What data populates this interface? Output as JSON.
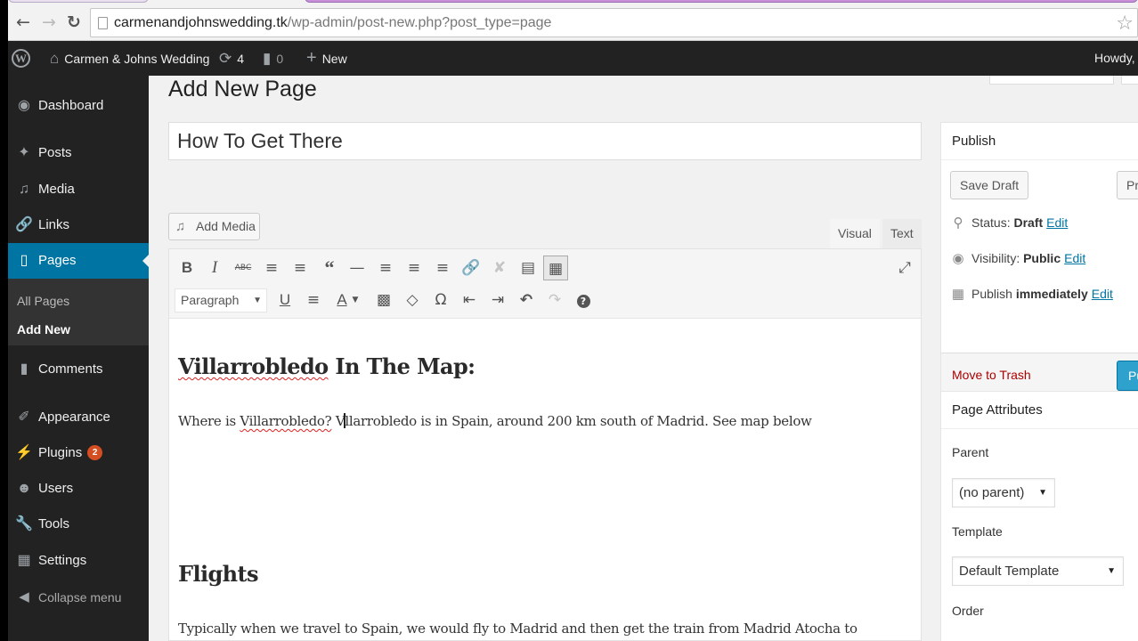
{
  "browser": {
    "url_domain": "carmenandjohnswedding.tk",
    "url_path": "/wp-admin/post-new.php?post_type=page",
    "back_icon": "back-arrow-icon",
    "forward_icon": "forward-arrow-icon",
    "reload_icon": "reload-icon",
    "bookmark_icon": "star-icon"
  },
  "adminbar": {
    "site_name": "Carmen & Johns Wedding",
    "updates_count": "4",
    "comments_count": "0",
    "new_label": "New",
    "howdy": "Howdy,"
  },
  "sidebar": {
    "items": [
      {
        "label": "Dashboard",
        "icon": "dashboard-icon"
      },
      {
        "label": "Posts",
        "icon": "pin-icon"
      },
      {
        "label": "Media",
        "icon": "media-icon"
      },
      {
        "label": "Links",
        "icon": "link-icon"
      },
      {
        "label": "Pages",
        "icon": "pages-icon",
        "current": true
      },
      {
        "label": "Comments",
        "icon": "comment-icon"
      },
      {
        "label": "Appearance",
        "icon": "brush-icon"
      },
      {
        "label": "Plugins",
        "icon": "plug-icon",
        "badge": "2"
      },
      {
        "label": "Users",
        "icon": "user-icon"
      },
      {
        "label": "Tools",
        "icon": "wrench-icon"
      },
      {
        "label": "Settings",
        "icon": "settings-icon"
      }
    ],
    "submenu": [
      {
        "label": "All Pages"
      },
      {
        "label": "Add New",
        "active": true
      }
    ],
    "collapse_label": "Collapse menu"
  },
  "main": {
    "page_title": "Add New Page",
    "post_title_value": "How To Get There",
    "add_media_label": "Add Media",
    "tabs": {
      "visual": "Visual",
      "text": "Text"
    },
    "format_select_value": "Paragraph",
    "content": {
      "heading1": "Villarrobledo In The Map:",
      "para1_a": "Where is ",
      "para1_spell": "Villarrobledo?",
      "para1_b": " V",
      "para1_c": "llarrobledo is in Spain, around 200 km south of Madrid. See map below",
      "heading2": "Flights",
      "para2": "Typically when we travel to Spain, we would fly to Madrid and then get the train from Madrid Atocha to"
    }
  },
  "publish": {
    "title": "Publish",
    "save_draft": "Save Draft",
    "preview": "Preview",
    "status_label": "Status:",
    "status_value": "Draft",
    "visibility_label": "Visibility:",
    "visibility_value": "Public",
    "publish_label": "Publish",
    "publish_value": "immediately",
    "edit": "Edit",
    "move_to_trash": "Move to Trash",
    "publish_button": "Publish"
  },
  "page_attributes": {
    "title": "Page Attributes",
    "parent_label": "Parent",
    "parent_value": "(no parent)",
    "template_label": "Template",
    "template_value": "Default Template",
    "order_label": "Order"
  }
}
